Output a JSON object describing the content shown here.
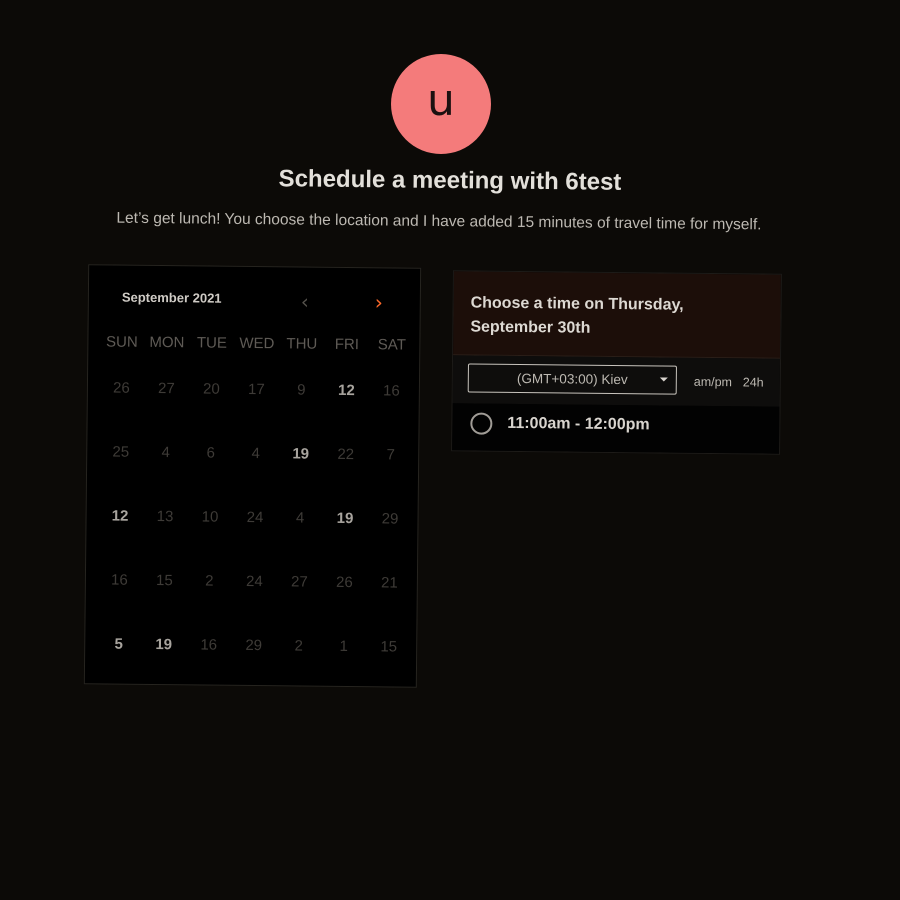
{
  "host": {
    "avatar_letter": "u",
    "avatar_color": "#f47b7b"
  },
  "header": {
    "title": "Schedule a meeting with 6test",
    "description": "Let’s get lunch! You choose the location and I have added 15 minutes of travel time for myself."
  },
  "calendar": {
    "month_label": "September 2021",
    "prev_icon": "chevron-left-icon",
    "next_icon": "chevron-right-icon",
    "weekdays": [
      "SUN",
      "MON",
      "TUE",
      "WED",
      "THU",
      "FRI",
      "SAT"
    ],
    "weeks": [
      [
        {
          "d": "26",
          "a": false
        },
        {
          "d": "27",
          "a": false
        },
        {
          "d": "20",
          "a": false
        },
        {
          "d": "17",
          "a": false
        },
        {
          "d": "9",
          "a": false
        },
        {
          "d": "12",
          "a": true
        },
        {
          "d": "16",
          "a": false
        }
      ],
      [
        {
          "d": "25",
          "a": false
        },
        {
          "d": "4",
          "a": false
        },
        {
          "d": "6",
          "a": false
        },
        {
          "d": "4",
          "a": false
        },
        {
          "d": "19",
          "a": true
        },
        {
          "d": "22",
          "a": false
        },
        {
          "d": "7",
          "a": false
        }
      ],
      [
        {
          "d": "12",
          "a": true
        },
        {
          "d": "13",
          "a": false
        },
        {
          "d": "10",
          "a": false
        },
        {
          "d": "24",
          "a": false
        },
        {
          "d": "4",
          "a": false
        },
        {
          "d": "19",
          "a": true
        },
        {
          "d": "29",
          "a": false
        }
      ],
      [
        {
          "d": "16",
          "a": false
        },
        {
          "d": "15",
          "a": false
        },
        {
          "d": "2",
          "a": false
        },
        {
          "d": "24",
          "a": false
        },
        {
          "d": "27",
          "a": false
        },
        {
          "d": "26",
          "a": false
        },
        {
          "d": "21",
          "a": false
        }
      ],
      [
        {
          "d": "5",
          "a": true
        },
        {
          "d": "19",
          "a": true
        },
        {
          "d": "16",
          "a": false
        },
        {
          "d": "29",
          "a": false
        },
        {
          "d": "2",
          "a": false
        },
        {
          "d": "1",
          "a": false
        },
        {
          "d": "15",
          "a": false
        }
      ]
    ],
    "accent_color": "#ff6a2a"
  },
  "times": {
    "heading": "Choose a time on Thursday, September 30th",
    "timezone": "(GMT+03:00) Kiev",
    "format_12h": "am/pm",
    "format_24h": "24h",
    "slots": [
      "11:00am - 12:00pm"
    ]
  }
}
